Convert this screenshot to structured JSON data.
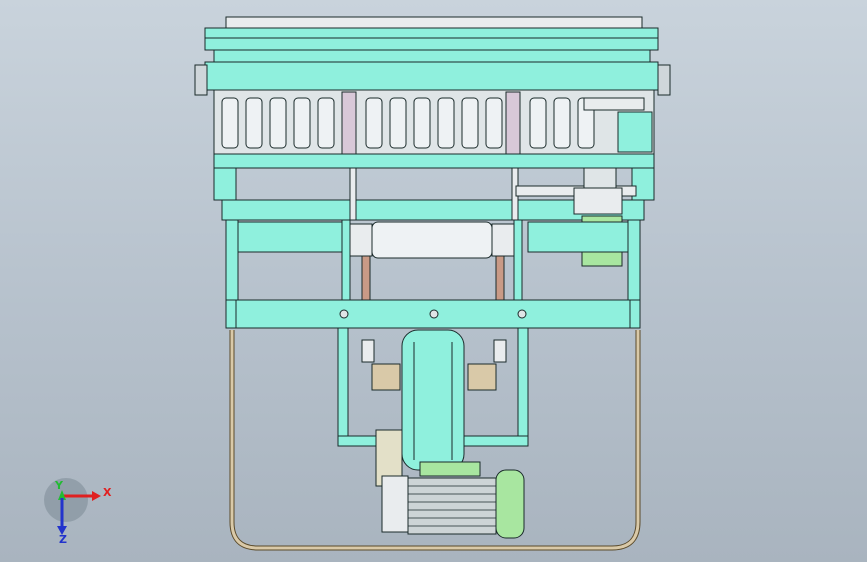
{
  "viewport": {
    "background_top": "#c9d3dc",
    "background_bottom": "#a9b4bf"
  },
  "model": {
    "frame_color": "#8ff0dd",
    "roller_color": "#eef2f4",
    "motor_color": "#a8e6a0",
    "hoop_color": "#d9c9a8",
    "shaft_color": "#c99a86"
  },
  "triad": {
    "x_label": "X",
    "y_label": "Y",
    "z_label": "Z",
    "x_color": "#e02020",
    "y_color": "#22bb33",
    "z_color": "#2233cc"
  }
}
